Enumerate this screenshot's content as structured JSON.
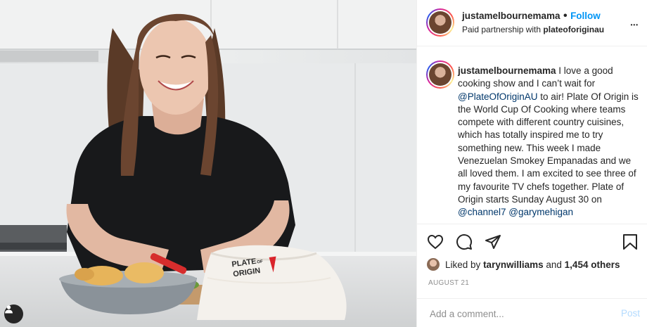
{
  "header": {
    "username": "justamelbournemama",
    "dot": "•",
    "follow_label": "Follow",
    "partnership_prefix": "Paid partnership with",
    "partner": "plateoforiginau",
    "more_label": "•••"
  },
  "caption": {
    "username": "justamelbournemama",
    "text_before_mention": " I love a good cooking show and I can’t wait for ",
    "mention_1": "@PlateOfOriginAU",
    "text_middle": " to air! Plate Of Origin is the World Cup Of Cooking where teams compete with different country cuisines, which has totally inspired me to try something new. This week I made Venezuelan Smokey Empanadas and we all loved them. I am excited to see three of my favourite TV chefs together. Plate of Origin starts Sunday August 30 on ",
    "mention_2": "@channel7",
    "mention_3": "@garymehigan"
  },
  "photo": {
    "bag_text_line1": "PLATE",
    "bag_text_line2": "ORIGIN",
    "bag_text_of": "OF"
  },
  "actions": {
    "liked_by_prefix": "Liked by",
    "liked_by_user": "tarynwilliams",
    "liked_by_and": "and",
    "others_count": "1,454 others",
    "date": "AUGUST 21"
  },
  "comment_box": {
    "placeholder": "Add a comment...",
    "post_label": "Post"
  },
  "colors": {
    "follow_blue": "#0095f6",
    "post_disabled": "#b3dbff",
    "mention": "#00376b",
    "muted": "#8e8e8e"
  }
}
